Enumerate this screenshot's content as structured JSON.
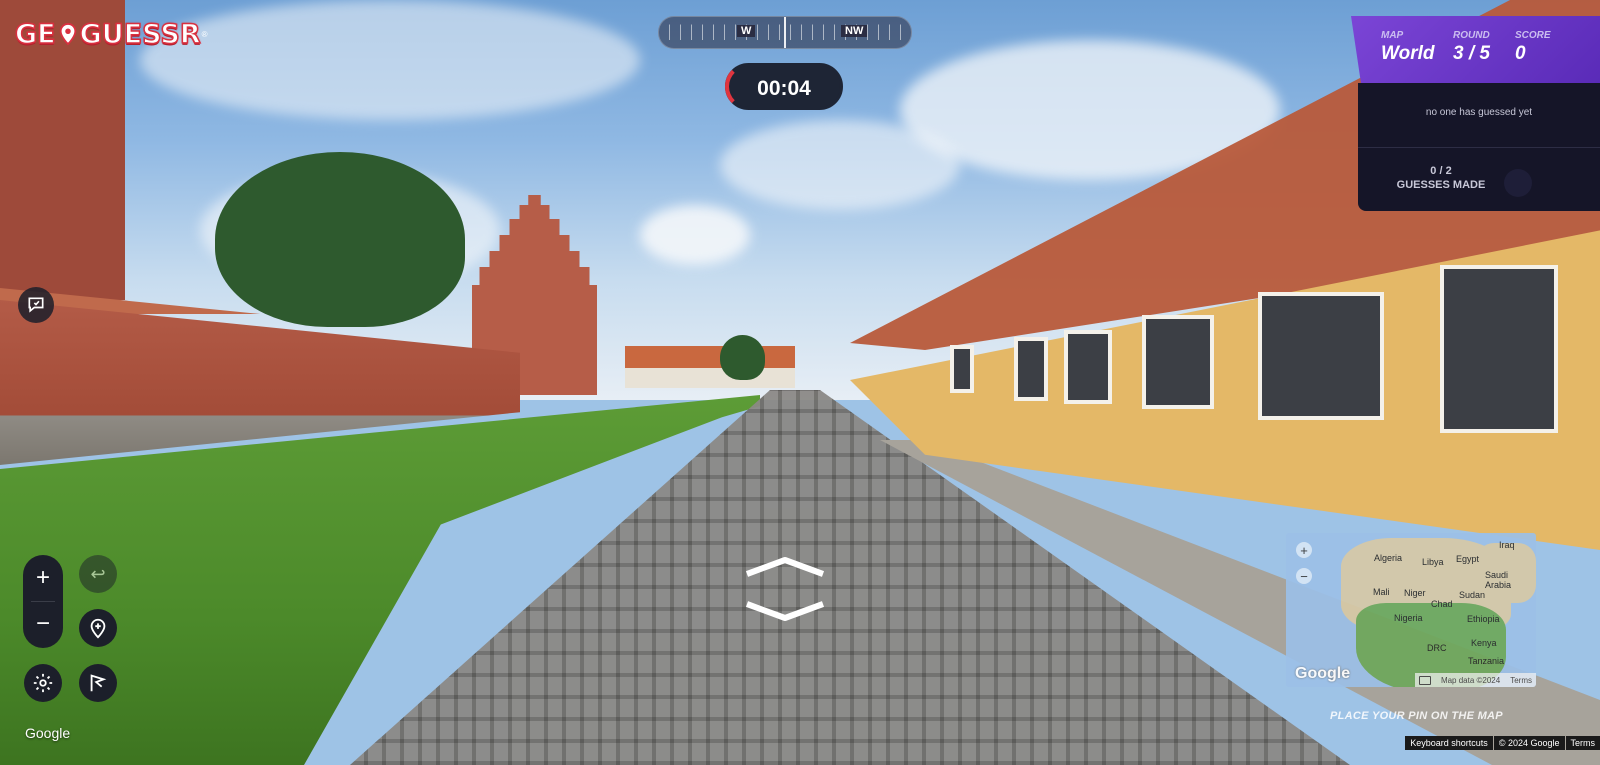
{
  "logo": {
    "text_left": "GE",
    "text_right": "GUESSR",
    "trademark": "®"
  },
  "compass": {
    "labels": [
      "W",
      "NW"
    ]
  },
  "timer": {
    "value": "00:04"
  },
  "game_panel": {
    "map_label": "MAP",
    "map_value": "World",
    "round_label": "ROUND",
    "round_value": "3 / 5",
    "score_label": "SCORE",
    "score_value": "0",
    "status_text": "no one has guessed yet",
    "guesses_count": "0 / 2",
    "guesses_label": "GUESSES MADE"
  },
  "controls": {
    "zoom_in": "+",
    "zoom_out": "−",
    "undo": "↩",
    "google_watermark": "Google"
  },
  "minimap": {
    "labels": [
      "Algeria",
      "Libya",
      "Egypt",
      "Iraq",
      "Saudi Arabia",
      "Mali",
      "Niger",
      "Chad",
      "Sudan",
      "Nigeria",
      "Ethiopia",
      "DRC",
      "Kenya",
      "Tanzania"
    ],
    "zoom_in": "+",
    "zoom_out": "−",
    "google_logo": "Google",
    "map_data": "Map data ©2024",
    "terms": "Terms",
    "place_pin_hint": "PLACE YOUR PIN ON THE MAP"
  },
  "bottom_bar": {
    "shortcuts": "Keyboard shortcuts",
    "copyright": "© 2024 Google",
    "terms": "Terms"
  },
  "colors": {
    "brand_red": "#d9303f",
    "panel_purple": "#6b38c8",
    "panel_dark": "#151528",
    "hud_dark": "#1c1f2a"
  },
  "icons": [
    "chat-icon",
    "zoom-in-icon",
    "zoom-out-icon",
    "undo-icon",
    "add-pin-icon",
    "settings-icon",
    "flag-icon",
    "move-forward-icon",
    "move-backward-icon"
  ]
}
